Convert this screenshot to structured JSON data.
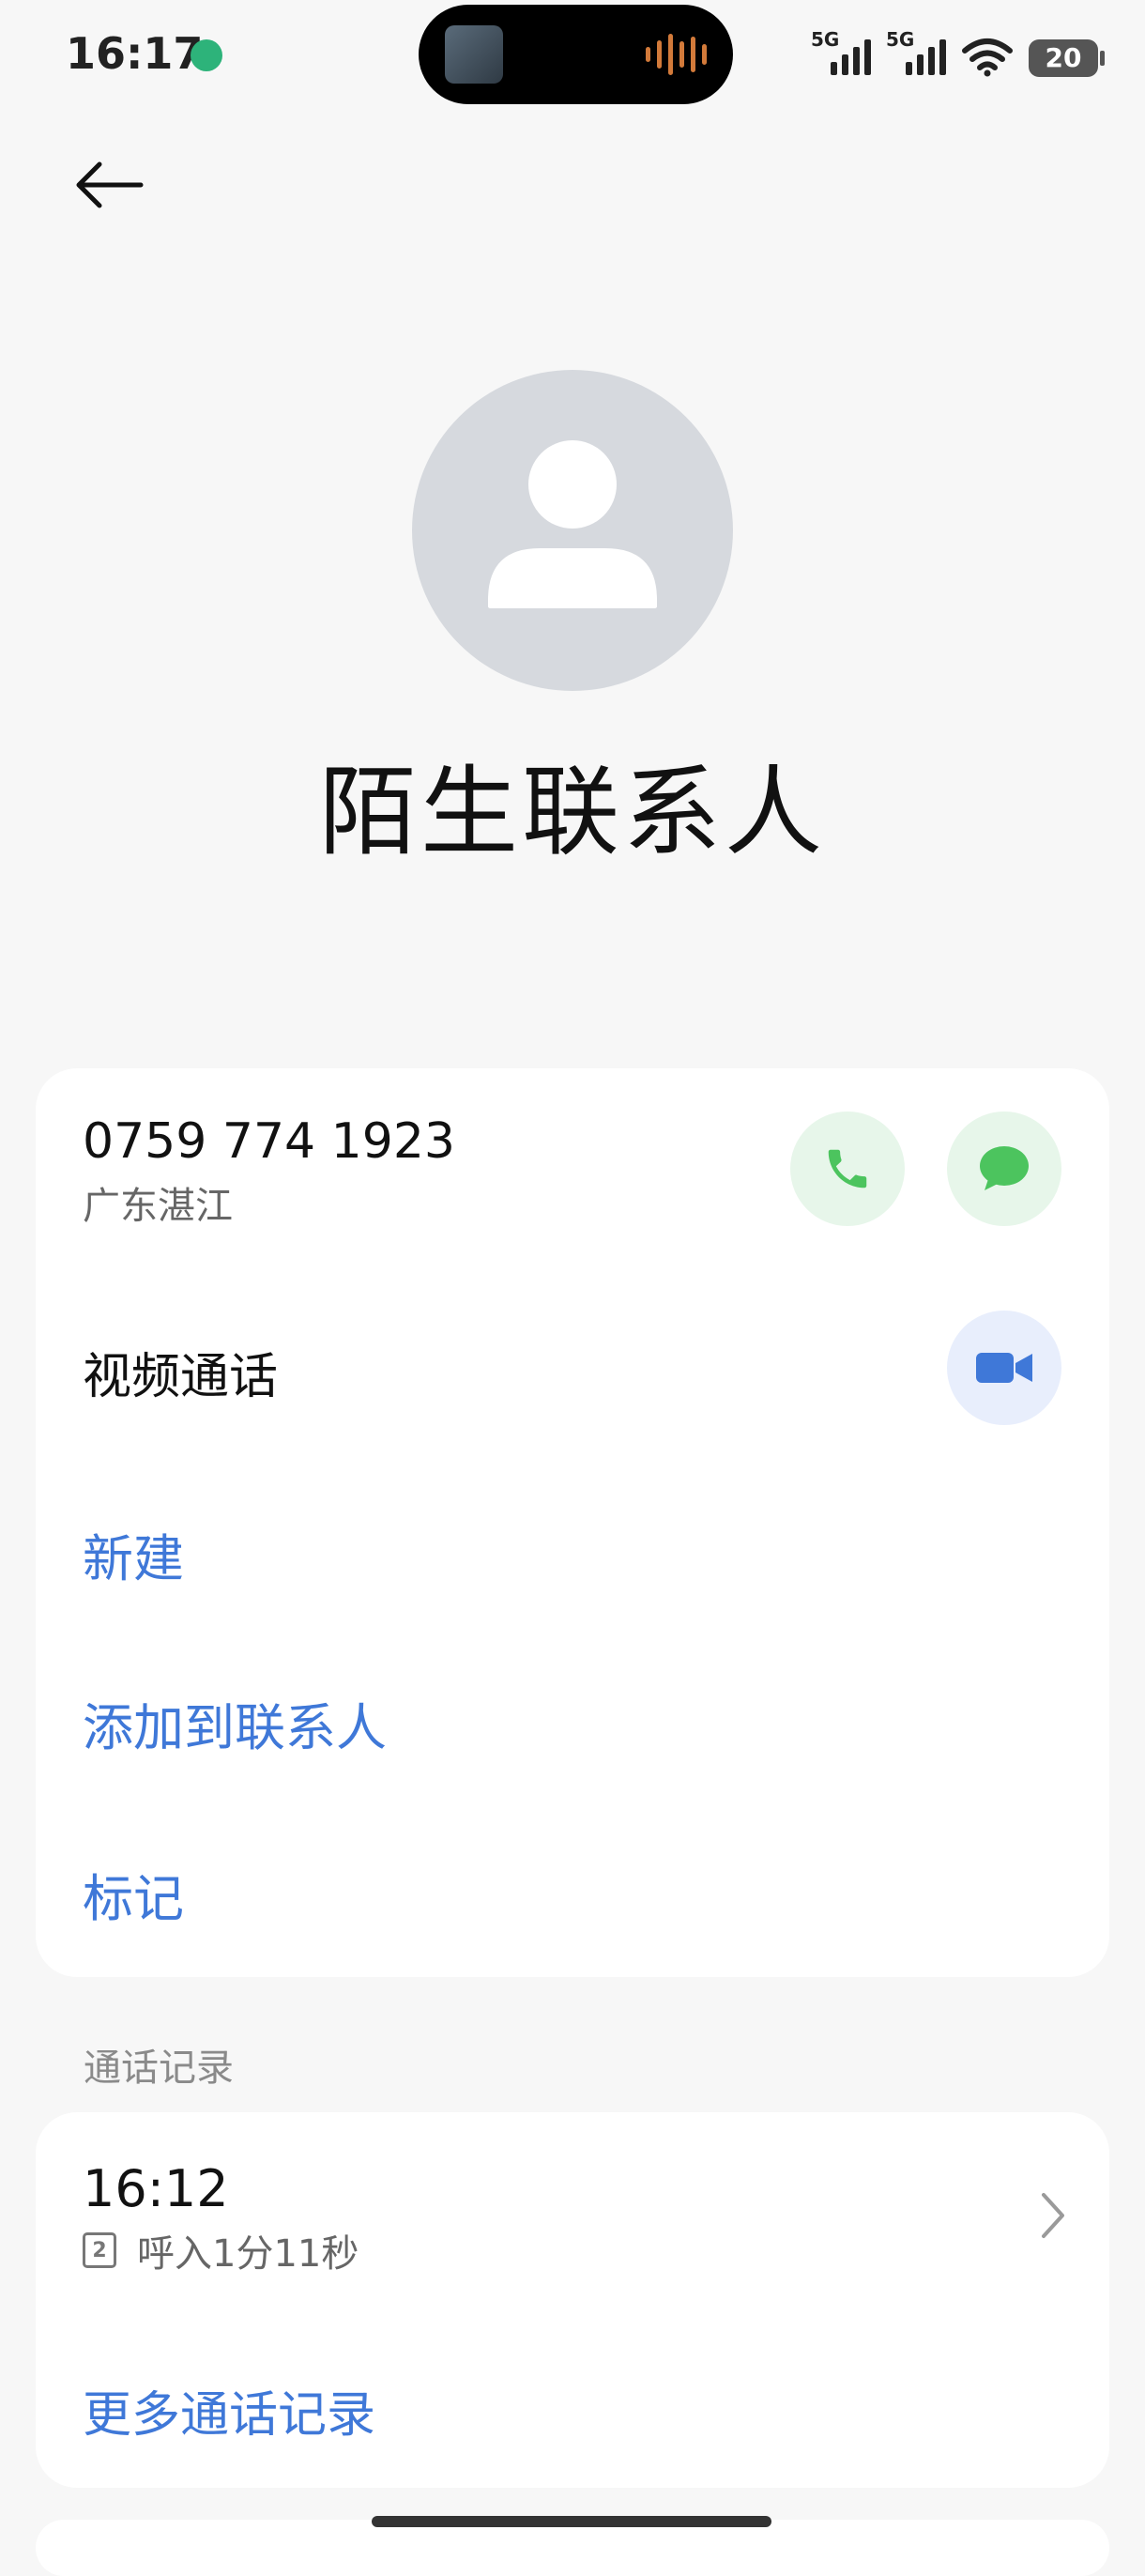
{
  "status_bar": {
    "time": "16:17",
    "signal1_label": "5G",
    "signal2_label": "5G",
    "battery": "20"
  },
  "header": {
    "back_icon": "arrow-left-icon"
  },
  "contact": {
    "avatar_icon": "person-icon",
    "name": "陌生联系人",
    "phone": "0759 774 1923",
    "location": "广东湛江"
  },
  "actions": {
    "call_icon": "phone-icon",
    "message_icon": "message-icon",
    "video_label": "视频通话",
    "video_icon": "video-camera-icon",
    "new": "新建",
    "add_to_contacts": "添加到联系人",
    "mark": "标记"
  },
  "call_log": {
    "section_title": "通话记录",
    "entries": [
      {
        "time": "16:12",
        "sim": "2",
        "detail": "呼入1分11秒"
      }
    ],
    "more": "更多通话记录"
  },
  "colors": {
    "accent_blue": "#3f78d8",
    "green": "#4cc45e",
    "green_bg": "#e7f6ea",
    "blue_bg": "#e8eefc",
    "avatar_bg": "#d6d9de"
  }
}
